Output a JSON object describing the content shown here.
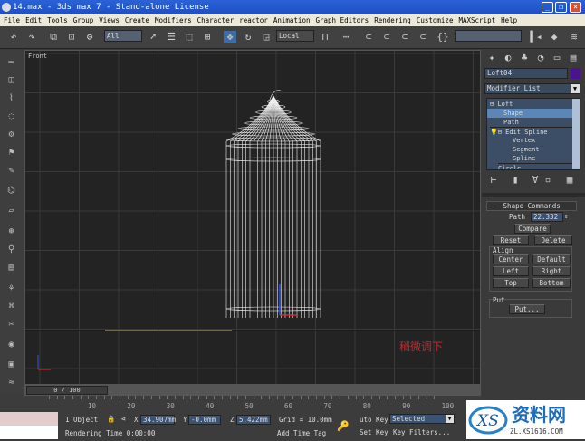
{
  "window": {
    "title": "14.max - 3ds max 7 - Stand-alone License"
  },
  "menu": [
    "File",
    "Edit",
    "Tools",
    "Group",
    "Views",
    "Create",
    "Modifiers",
    "Character",
    "reactor",
    "Animation",
    "Graph Editors",
    "Rendering",
    "Customize",
    "MAXScript",
    "Help"
  ],
  "toolbar": {
    "selection_filter": "All",
    "ref_coord": "Local"
  },
  "viewport": {
    "label": "Front",
    "annotation": "稍微调下"
  },
  "panel": {
    "object_name": "Loft04",
    "object_color": "#4a148c",
    "modifier_list": "Modifier List",
    "stack": [
      "Loft",
      "Shape",
      "Path",
      "Edit Spline",
      "Vertex",
      "Segment",
      "Spline",
      "Circle"
    ],
    "rollout_title": "Shape Commands",
    "path_label": "Path",
    "path_value": "22.332",
    "compare": "Compare",
    "reset": "Reset",
    "delete": "Delete",
    "align_label": "Align",
    "center": "Center",
    "default": "Default",
    "left": "Left",
    "right": "Right",
    "top": "Top",
    "bottom": "Bottom",
    "put_label": "Put",
    "put_button": "Put..."
  },
  "timeline": {
    "slider": "0 / 100",
    "ticks": [
      "10",
      "20",
      "30",
      "40",
      "50",
      "60",
      "70",
      "80",
      "90",
      "100"
    ]
  },
  "status": {
    "selection": "1 Object",
    "x_label": "X",
    "x": "34.907mm",
    "y_label": "Y",
    "y": "-0.0mm",
    "z_label": "Z",
    "z": "5.422mm",
    "grid": "Grid = 10.0mm",
    "auto_key": "uto Key",
    "key_mode": "Selected",
    "set_key": "Set Key",
    "key_filters": "Key Filters...",
    "rendering_time": "Rendering Time  0:00:00",
    "add_time_tag": "Add Time Tag"
  },
  "watermark": {
    "brand": "资料网",
    "url": "ZL.XS1616.COM"
  }
}
